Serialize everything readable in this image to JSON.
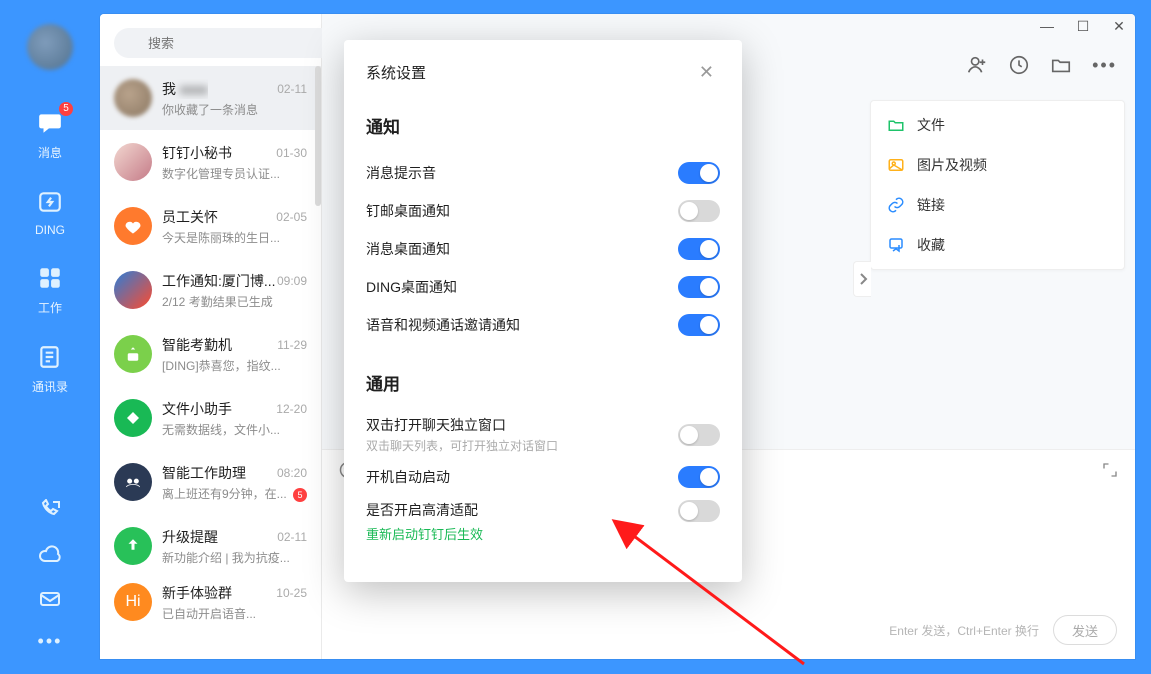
{
  "sidebar": {
    "badge": "5",
    "items": [
      {
        "label": "消息"
      },
      {
        "label": "DING"
      },
      {
        "label": "工作"
      },
      {
        "label": "通讯录"
      }
    ]
  },
  "search": {
    "placeholder": "搜索"
  },
  "chats": [
    {
      "name": "我",
      "snippet": "你收藏了一条消息",
      "time": "02-11",
      "avatar_type": "photo"
    },
    {
      "name": "钉钉小秘书",
      "snippet": "数字化管理专员认证...",
      "time": "01-30",
      "avatar_type": "photo2"
    },
    {
      "name": "员工关怀",
      "snippet": "今天是陈丽珠的生日...",
      "time": "02-05",
      "avatar_bg": "#ff7a2d"
    },
    {
      "name": "工作通知:厦门博...",
      "snippet": "2/12 考勤结果已生成",
      "time": "09:09",
      "avatar_bg": "#1296db"
    },
    {
      "name": "智能考勤机",
      "snippet": "[DING]恭喜您，指纹...",
      "time": "11-29",
      "avatar_bg": "#7bd04b"
    },
    {
      "name": "文件小助手",
      "snippet": "无需数据线，文件小...",
      "time": "12-20",
      "avatar_bg": "#19b955"
    },
    {
      "name": "智能工作助理",
      "snippet": "离上班还有9分钟，在...",
      "time": "08:20",
      "avatar_bg": "#2b3a55",
      "dot": "5"
    },
    {
      "name": "升级提醒",
      "snippet": "新功能介绍 | 我为抗疫...",
      "time": "02-11",
      "avatar_bg": "#28c159"
    },
    {
      "name": "新手体验群",
      "snippet": "已自动开启语音...",
      "time": "10-25",
      "avatar_bg": "#ff8a1f"
    }
  ],
  "files_panel": {
    "items": [
      {
        "label": "文件",
        "color": "#1ec36a"
      },
      {
        "label": "图片及视频",
        "color": "#ffb11b"
      },
      {
        "label": "链接",
        "color": "#2a8cff"
      },
      {
        "label": "收藏",
        "color": "#2a8cff"
      }
    ]
  },
  "compose": {
    "hint": "Enter 发送，Ctrl+Enter 换行",
    "send": "发送"
  },
  "modal": {
    "title": "系统设置",
    "section_notify": "通知",
    "rows_notify": [
      {
        "label": "消息提示音",
        "on": true
      },
      {
        "label": "钉邮桌面通知",
        "on": false
      },
      {
        "label": "消息桌面通知",
        "on": true
      },
      {
        "label": "DING桌面通知",
        "on": true
      },
      {
        "label": "语音和视频通话邀请通知",
        "on": true
      }
    ],
    "section_general": "通用",
    "rows_general": [
      {
        "label": "双击打开聊天独立窗口",
        "sub": "双击聊天列表，可打开独立对话窗口",
        "on": false
      },
      {
        "label": "开机自动启动",
        "on": true
      },
      {
        "label": "是否开启高清适配",
        "note": "重新启动钉钉后生效",
        "on": false
      }
    ]
  }
}
